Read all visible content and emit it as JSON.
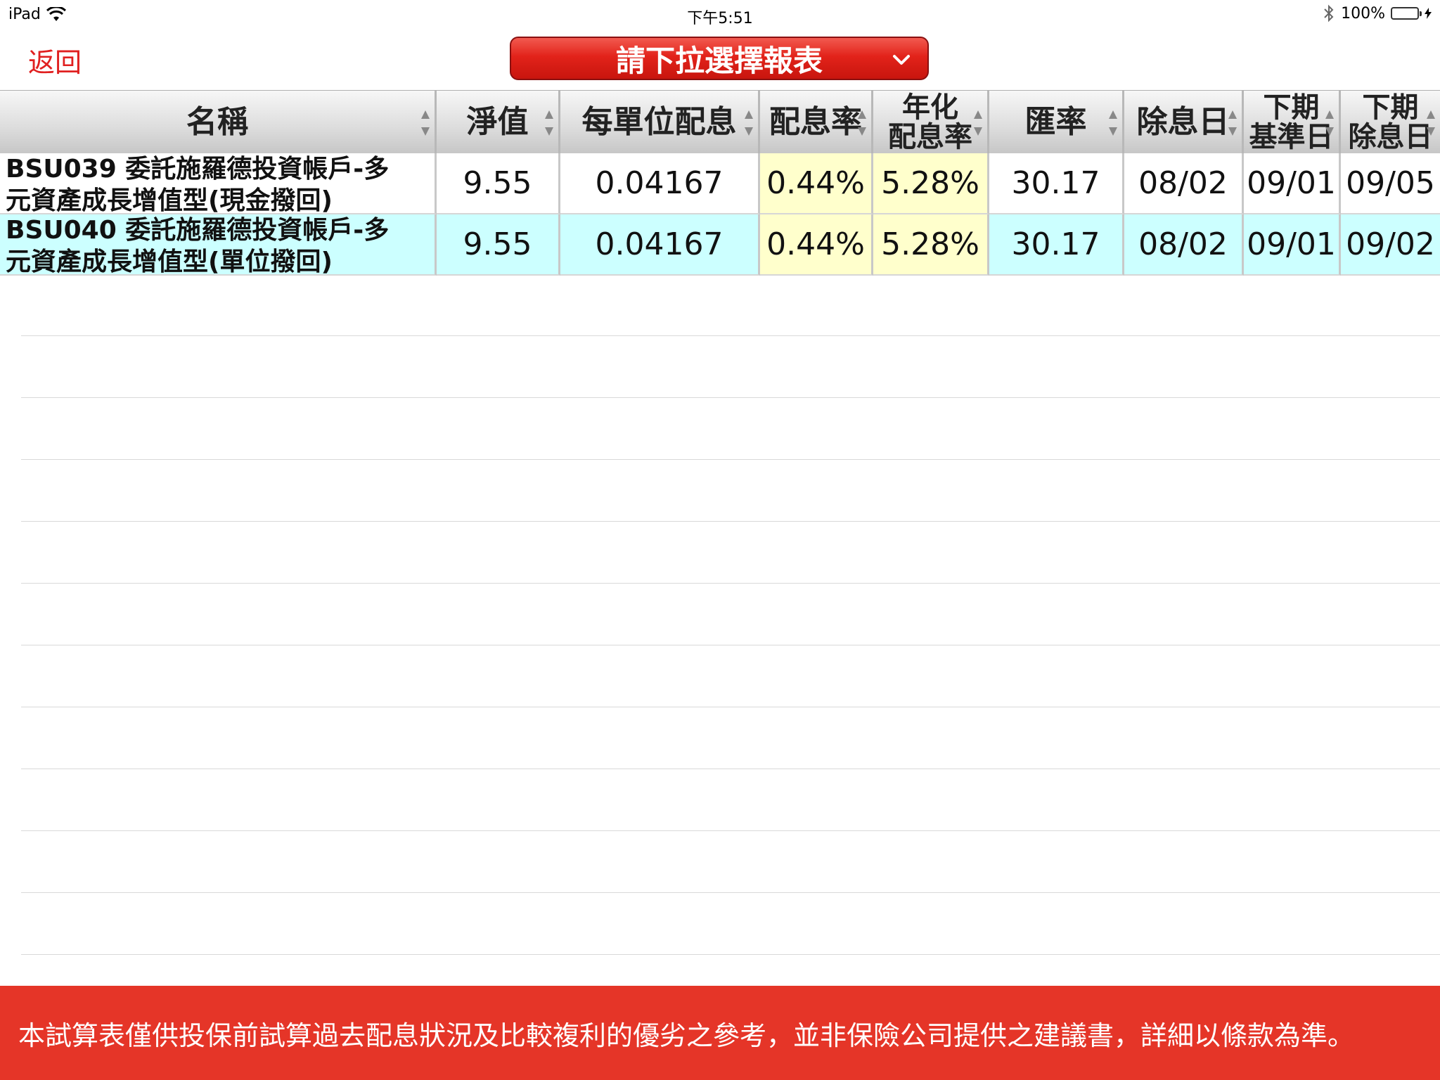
{
  "status_bar": {
    "device": "iPad",
    "time": "下午5:51",
    "battery": "100%"
  },
  "nav": {
    "back_label": "返回",
    "report_select_label": "請下拉選擇報表"
  },
  "table": {
    "headers": {
      "name": "名稱",
      "nav": "淨值",
      "dividend_per_unit": "每單位配息",
      "dividend_rate": "配息率",
      "annualized_line1": "年化",
      "annualized_line2": "配息率",
      "fx_rate": "匯率",
      "ex_date": "除息日",
      "next_base_line1": "下期",
      "next_base_line2": "基準日",
      "next_ex_line1": "下期",
      "next_ex_line2": "除息日"
    },
    "rows": [
      {
        "code": "BSU039",
        "name_line1": " 委託施羅德投資帳戶-多",
        "name_line2": "元資產成長增值型(現金撥回)",
        "nav": "9.55",
        "dividend_per_unit": "0.04167",
        "dividend_rate": "0.44%",
        "annualized_rate": "5.28%",
        "fx_rate": "30.17",
        "ex_date": "08/02",
        "next_base_date": "09/01",
        "next_ex_date": "09/05"
      },
      {
        "code": "BSU040",
        "name_line1": " 委託施羅德投資帳戶-多",
        "name_line2": "元資產成長增值型(單位撥回)",
        "nav": "9.55",
        "dividend_per_unit": "0.04167",
        "dividend_rate": "0.44%",
        "annualized_rate": "5.28%",
        "fx_rate": "30.17",
        "ex_date": "08/02",
        "next_base_date": "09/01",
        "next_ex_date": "09/02"
      }
    ]
  },
  "footer": {
    "disclaimer": "本試算表僅供投保前試算過去配息狀況及比較複利的優劣之參考，並非保險公司提供之建議書，詳細以條款為準。"
  },
  "colors": {
    "accent_red": "#e53528",
    "back_red": "#e02020",
    "row_highlight_cyan": "#ccffff",
    "cell_highlight_yellow": "#ffffcc"
  }
}
